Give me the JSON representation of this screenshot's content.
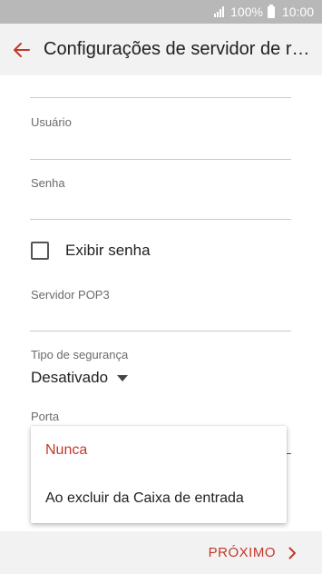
{
  "status_bar": {
    "battery": "100%",
    "time": "10:00"
  },
  "app_bar": {
    "title": "Configurações de servidor de rec…",
    "back_icon": "arrow-left-icon"
  },
  "form": {
    "username_label": "Usuário",
    "password_label": "Senha",
    "show_password_label": "Exibir senha",
    "pop3_label": "Servidor POP3",
    "security_label": "Tipo de segurança",
    "security_value": "Desativado",
    "port_label": "Porta"
  },
  "dropdown": {
    "options": [
      {
        "label": "Nunca",
        "selected": true
      },
      {
        "label": "Ao excluir da Caixa de entrada",
        "selected": false
      }
    ]
  },
  "bottom_bar": {
    "next_label": "PRÓXIMO"
  },
  "colors": {
    "accent": "#c0392b",
    "status_bar": "#b8b8b8",
    "app_bar": "#f2f2f2"
  }
}
